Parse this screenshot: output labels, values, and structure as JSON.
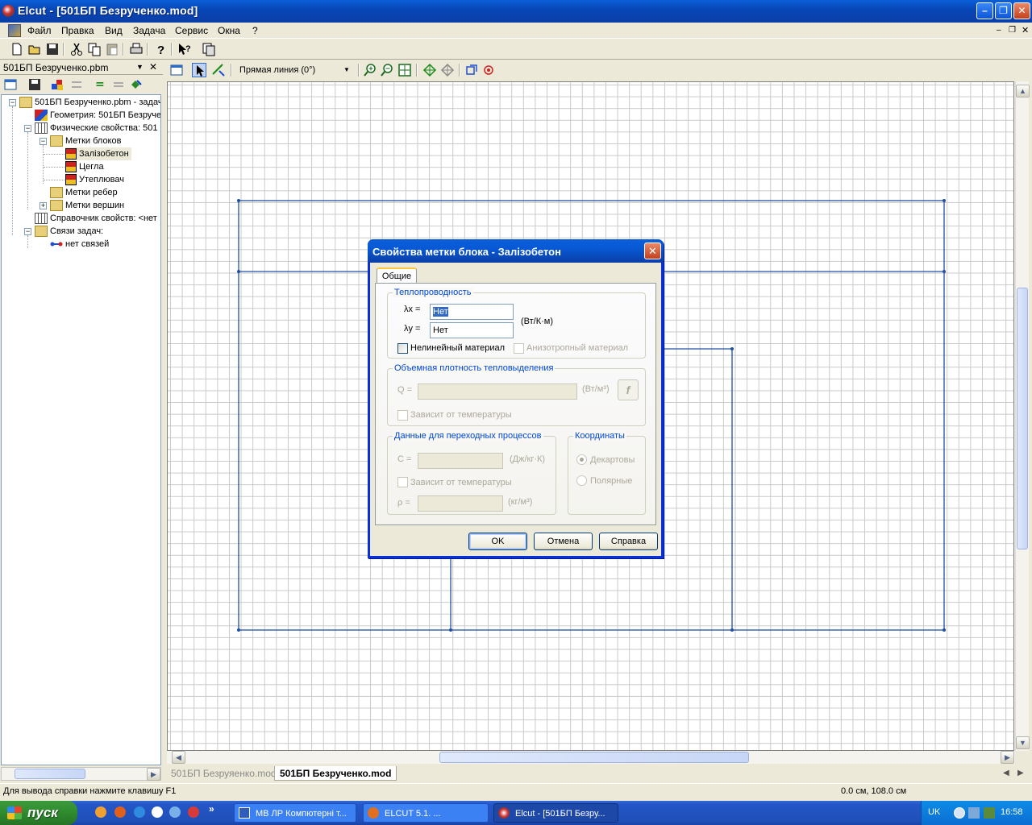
{
  "window": {
    "title": "Elcut - [501БП Безрученко.mod]"
  },
  "menu": {
    "items": [
      "Файл",
      "Правка",
      "Вид",
      "Задача",
      "Сервис",
      "Окна",
      "?"
    ]
  },
  "left_panel": {
    "title": "501БП Безрученко.pbm",
    "tree": [
      {
        "label": "501БП Безрученко.pbm - задач",
        "icon": "folder-open-icon"
      },
      {
        "label": "Геометрия: 501БП Безруче",
        "icon": "geometry-icon"
      },
      {
        "label": "Физические свойства: 501",
        "icon": "table-icon"
      },
      {
        "label": "Метки блоков",
        "icon": "folder-open-icon"
      },
      {
        "label": "Залізобетон",
        "icon": "block-label-icon"
      },
      {
        "label": "Цегла",
        "icon": "block-label-icon"
      },
      {
        "label": "Утеплювач",
        "icon": "block-label-icon"
      },
      {
        "label": "Метки ребер",
        "icon": "folder-icon"
      },
      {
        "label": "Метки вершин",
        "icon": "folder-icon"
      },
      {
        "label": "Справочник свойств: <нет",
        "icon": "table-icon"
      },
      {
        "label": "Связи задач:",
        "icon": "folder-open-icon"
      },
      {
        "label": "нет связей",
        "icon": "link-icon"
      }
    ]
  },
  "workspace": {
    "line_mode": "Прямая линия (0°)"
  },
  "doc_tabs": [
    "501БП Безруяенко.mod",
    "501БП Безрученко.mod"
  ],
  "status": {
    "help": "Для вывода справки нажмите клавишу F1",
    "coords": "0.0 см, 108.0 см"
  },
  "dialog": {
    "title": "Свойства метки блока - Залізобетон",
    "tab": "Общие",
    "thermal": {
      "group": "Теплопроводность",
      "lx_label": "λx =",
      "ly_label": "λy =",
      "lx_value": "Нет",
      "ly_value": "Нет",
      "unit": "(Вт/К·м)",
      "nonlinear": "Нелинейный материал",
      "anisotropic": "Анизотропный материал"
    },
    "heat": {
      "group": "Объемная плотность тепловыделения",
      "q_label": "Q =",
      "unit": "(Вт/м³)",
      "func_btn": "f",
      "temp_dep": "Зависит от температуры"
    },
    "transient": {
      "group": "Данные для переходных процессов",
      "c_label": "C =",
      "c_unit": "(Дж/кг·К)",
      "temp_dep": "Зависит от температуры",
      "rho_label": "ρ =",
      "rho_unit": "(кг/м³)"
    },
    "coords": {
      "group": "Координаты",
      "cartesian": "Декартовы",
      "polar": "Полярные"
    },
    "buttons": {
      "ok": "OK",
      "cancel": "Отмена",
      "help": "Справка"
    }
  },
  "taskbar": {
    "start": "пуск",
    "tasks": [
      "МВ ЛР Компютерні т...",
      "ELCUT 5.1.            ...",
      "Elcut - [501БП Безру..."
    ],
    "lang": "UK",
    "clock": "16:58"
  }
}
